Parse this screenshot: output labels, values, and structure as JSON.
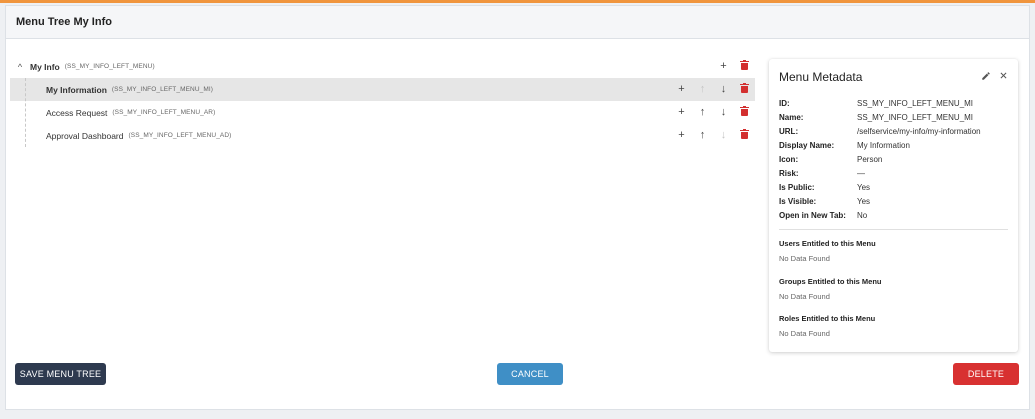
{
  "header": {
    "title": "Menu Tree My Info"
  },
  "tree": {
    "root": {
      "label": "My Info",
      "code": "(SS_MY_INFO_LEFT_MENU)"
    },
    "children": [
      {
        "label": "My Information",
        "code": "(SS_MY_INFO_LEFT_MENU_MI)",
        "selected": true
      },
      {
        "label": "Access Request",
        "code": "(SS_MY_INFO_LEFT_MENU_AR)",
        "selected": false
      },
      {
        "label": "Approval Dashboard",
        "code": "(SS_MY_INFO_LEFT_MENU_AD)",
        "selected": false
      }
    ],
    "icons": {
      "add": "+",
      "up": "↑",
      "down": "↓",
      "collapse": "^"
    }
  },
  "metadata": {
    "title": "Menu Metadata",
    "fields": [
      {
        "key": "ID:",
        "value": "SS_MY_INFO_LEFT_MENU_MI"
      },
      {
        "key": "Name:",
        "value": "SS_MY_INFO_LEFT_MENU_MI"
      },
      {
        "key": "URL:",
        "value": "/selfservice/my-info/my-information"
      },
      {
        "key": "Display Name:",
        "value": "My Information"
      },
      {
        "key": "Icon:",
        "value": "Person"
      },
      {
        "key": "Risk:",
        "value": "—"
      },
      {
        "key": "Is Public:",
        "value": "Yes"
      },
      {
        "key": "Is Visible:",
        "value": "Yes"
      },
      {
        "key": "Open in New Tab:",
        "value": "No"
      }
    ],
    "sections": [
      {
        "title": "Users Entitled to this Menu",
        "empty": "No Data Found"
      },
      {
        "title": "Groups Entitled to this Menu",
        "empty": "No Data Found"
      },
      {
        "title": "Roles Entitled to this Menu",
        "empty": "No Data Found"
      }
    ]
  },
  "buttons": {
    "save": "SAVE MENU TREE",
    "cancel": "CANCEL",
    "delete": "DELETE"
  },
  "colors": {
    "accent_top": "#f0953d",
    "save": "#2e3a4f",
    "cancel": "#3f8fc6",
    "delete": "#d83131",
    "trash": "#d32f2f"
  }
}
